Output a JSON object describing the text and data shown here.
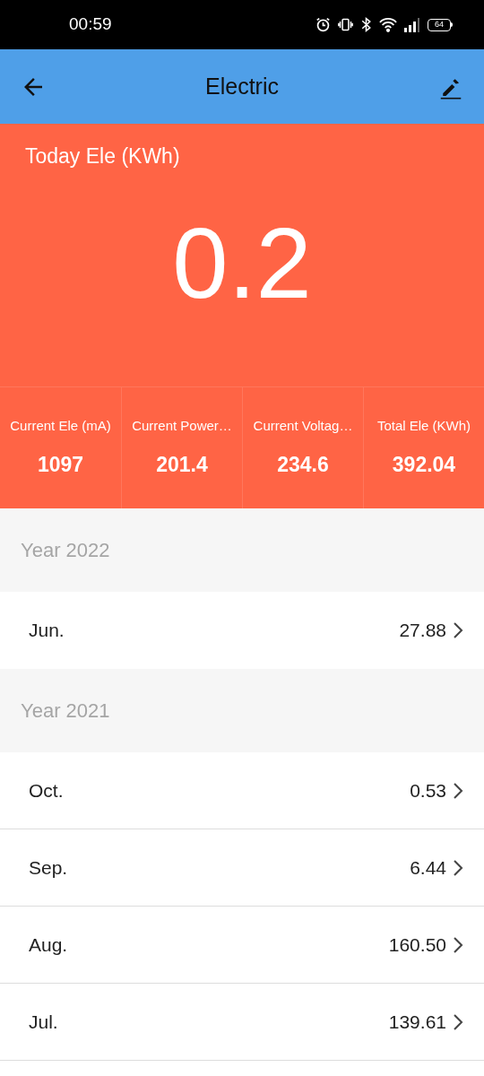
{
  "status_bar": {
    "time": "00:59",
    "battery": "64"
  },
  "header": {
    "title": "Electric"
  },
  "today": {
    "label": "Today Ele (KWh)",
    "value": "0.2"
  },
  "stats": [
    {
      "label": "Current Ele (mA)",
      "value": "1097"
    },
    {
      "label": "Current Power…",
      "value": "201.4"
    },
    {
      "label": "Current Voltag…",
      "value": "234.6"
    },
    {
      "label": "Total Ele (KWh)",
      "value": "392.04"
    }
  ],
  "sections": [
    {
      "year": "Year 2022",
      "months": [
        {
          "label": "Jun.",
          "value": "27.88"
        }
      ]
    },
    {
      "year": "Year 2021",
      "months": [
        {
          "label": "Oct.",
          "value": "0.53"
        },
        {
          "label": "Sep.",
          "value": "6.44"
        },
        {
          "label": "Aug.",
          "value": "160.50"
        },
        {
          "label": "Jul.",
          "value": "139.61"
        }
      ]
    }
  ]
}
